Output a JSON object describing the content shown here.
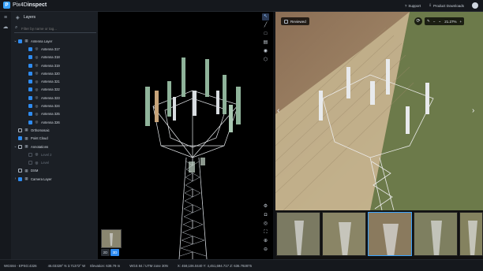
{
  "app": {
    "brand_prefix": "Pix4D",
    "brand_suffix": "inspect"
  },
  "header": {
    "support": "Support",
    "downloads": "Product Downloads"
  },
  "layers": {
    "title": "Layers",
    "filter_placeholder": "Filter by name or tag...",
    "items": [
      {
        "label": "Antenna Layer",
        "checked": true,
        "chevron": "v",
        "icon": "layer-icon"
      },
      {
        "label": "Antenna 317",
        "checked": true
      },
      {
        "label": "Antenna 318",
        "checked": true
      },
      {
        "label": "Antenna 319",
        "checked": true
      },
      {
        "label": "Antenna 320",
        "checked": true
      },
      {
        "label": "Antenna 321",
        "checked": true
      },
      {
        "label": "Antenna 322",
        "checked": true
      },
      {
        "label": "Antenna 323",
        "checked": true
      },
      {
        "label": "Antenna 324",
        "checked": true
      },
      {
        "label": "Antenna 325",
        "checked": true
      },
      {
        "label": "Antenna 326",
        "checked": true
      },
      {
        "label": "Orthomosaic",
        "checked": false
      },
      {
        "label": "Point Cloud",
        "checked": true
      },
      {
        "label": "Annotations",
        "checked": false,
        "chevron": "v"
      },
      {
        "label": "Level 2",
        "checked": false,
        "disabled": true
      },
      {
        "label": "Level",
        "checked": false,
        "disabled": true
      },
      {
        "label": "DSM",
        "checked": false
      },
      {
        "label": "Camera Layer",
        "checked": true,
        "chevron": ">"
      }
    ]
  },
  "viewer": {
    "view_2d": "2D",
    "view_3d": "3D"
  },
  "photo": {
    "reviewed_label": "Reviewed",
    "zoom_value": "21.27%",
    "minus": "−",
    "plus": "+"
  },
  "status": {
    "crs": "WGS84 - EPSG:4326",
    "coords": "46.03328° N 3.71372° W",
    "elevation": "Elevation: 638.79 m",
    "utm_zone": "WGS 84 / UTM zone 30N",
    "xyz": "X: 459,106.0440   Y: 4,451,694.717   Z: 636.792875"
  },
  "colors": {
    "accent": "#2e8bf0",
    "background": "#0f1115",
    "panel": "#1b1f25"
  }
}
